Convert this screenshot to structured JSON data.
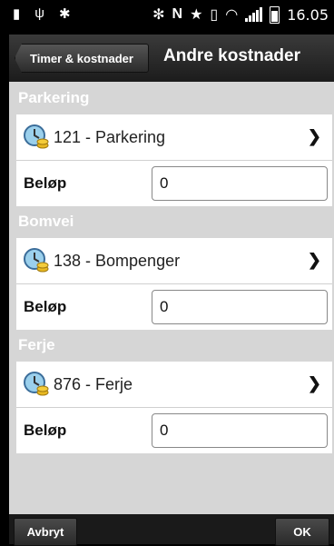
{
  "status_bar": {
    "time": "16.05",
    "icons_left": [
      "sim-card-icon",
      "usb-icon",
      "android-debug-icon"
    ],
    "icons_right": [
      "bluetooth-icon",
      "nfc-icon",
      "star-icon",
      "vibrate-icon",
      "wifi-icon",
      "signal-icon",
      "battery-icon"
    ]
  },
  "action_bar": {
    "back_label": "Timer & kostnader",
    "title": "Andre kostnader"
  },
  "sections": [
    {
      "title": "Parkering",
      "item_label": "121 - Parkering",
      "amount_label": "Beløp",
      "amount_value": "0"
    },
    {
      "title": "Bomvei",
      "item_label": "138 - Bompenger",
      "amount_label": "Beløp",
      "amount_value": "0"
    },
    {
      "title": "Ferje",
      "item_label": "876 - Ferje",
      "amount_label": "Beløp",
      "amount_value": "0"
    }
  ],
  "bottom_bar": {
    "cancel_label": "Avbryt",
    "ok_label": "OK"
  },
  "colors": {
    "background": "#d6d6d6",
    "action_bar": "#2a2a2a",
    "card": "#ffffff"
  }
}
